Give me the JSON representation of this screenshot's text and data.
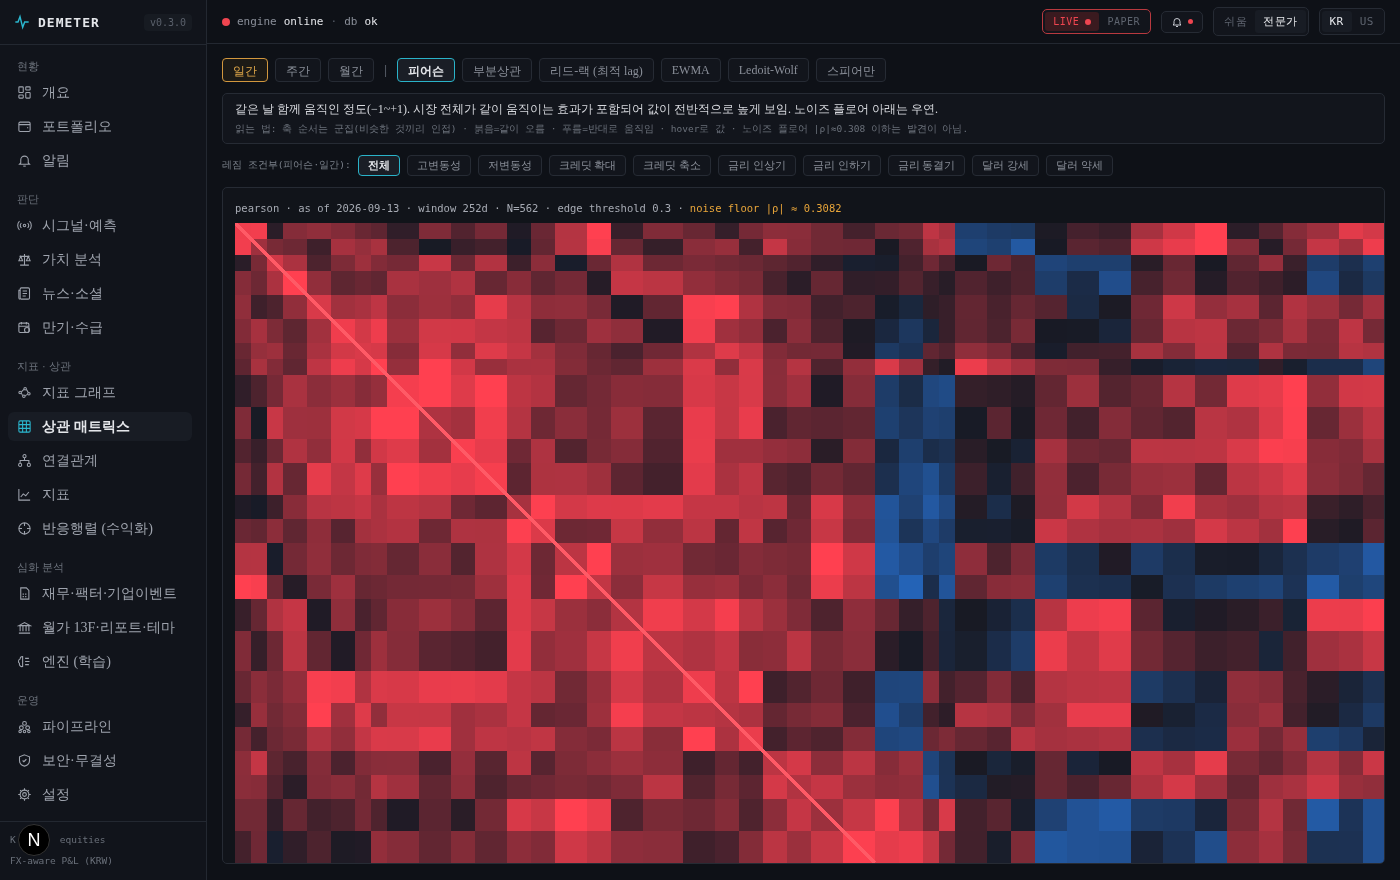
{
  "app": {
    "name": "DEMETER",
    "version": "v0.3.0"
  },
  "status": {
    "engine_label": "engine",
    "engine_state": "online",
    "separator": "·",
    "db_label": "db",
    "db_state": "ok"
  },
  "mode_toggle": [
    {
      "label": "LIVE",
      "selected": true
    },
    {
      "label": "PAPER",
      "selected": false
    }
  ],
  "notifications": {
    "unread": true
  },
  "level_toggle": [
    {
      "label": "쉬움",
      "selected": false
    },
    {
      "label": "전문가",
      "selected": true
    }
  ],
  "market_toggle": [
    {
      "label": "KR",
      "selected": true
    },
    {
      "label": "US",
      "selected": false
    }
  ],
  "sidebar": {
    "sections": [
      {
        "title": "현황",
        "items": [
          {
            "label": "개요",
            "selected": false
          },
          {
            "label": "포트폴리오",
            "selected": false
          },
          {
            "label": "알림",
            "selected": false
          }
        ]
      },
      {
        "title": "판단",
        "items": [
          {
            "label": "시그널·예측",
            "selected": false
          },
          {
            "label": "가치 분석",
            "selected": false
          },
          {
            "label": "뉴스·소셜",
            "selected": false
          },
          {
            "label": "만기·수급",
            "selected": false
          }
        ]
      },
      {
        "title": "지표 · 상관",
        "items": [
          {
            "label": "지표 그래프",
            "selected": false
          },
          {
            "label": "상관 매트릭스",
            "selected": true
          },
          {
            "label": "연결관계",
            "selected": false
          },
          {
            "label": "지표",
            "selected": false
          },
          {
            "label": "반응행렬 (수익화)",
            "selected": false
          }
        ]
      },
      {
        "title": "심화 분석",
        "items": [
          {
            "label": "재무·팩터·기업이벤트",
            "selected": false
          },
          {
            "label": "월가 13F·리포트·테마",
            "selected": false
          },
          {
            "label": "엔진 (학습)",
            "selected": false
          }
        ]
      },
      {
        "title": "운영",
        "items": [
          {
            "label": "파이프라인",
            "selected": false
          },
          {
            "label": "보안·무결성",
            "selected": false
          },
          {
            "label": "설정",
            "selected": false
          }
        ]
      }
    ]
  },
  "footer": {
    "line_1_start": "K",
    "line_1_end": "equities",
    "line_2": "FX-aware P&L (KRW)"
  },
  "dev_badge": {
    "letter": "N"
  },
  "frequency_tabs": [
    {
      "label": "일간",
      "selected": true
    },
    {
      "label": "주간",
      "selected": false
    },
    {
      "label": "월간",
      "selected": false
    }
  ],
  "tab_separator": "|",
  "method_tabs": [
    {
      "label": "피어슨",
      "selected": true
    },
    {
      "label": "부분상관",
      "selected": false
    },
    {
      "label": "리드-랙 (최적 lag)",
      "selected": false
    },
    {
      "label": "EWMA",
      "selected": false
    },
    {
      "label": "Ledoit-Wolf",
      "selected": false
    },
    {
      "label": "스피어만",
      "selected": false
    }
  ],
  "description": {
    "text": "같은 날 함께 움직인 정도(−1~+1). 시장 전체가 같이 움직이는 효과가 포함되어 값이 전반적으로 높게 보임. 노이즈 플로어 아래는 우연.",
    "hint": "읽는 법: 축 순서는 군집(비슷한 것끼리 인접) · 붉음=같이 오름 · 푸름=반대로 움직임 · hover로 값 · 노이즈 플로어 |ρ|≈0.308 이하는 발견이 아님."
  },
  "regime": {
    "label": "레짐 조건부(피어슨·일간):",
    "chips": [
      {
        "label": "전체",
        "selected": true
      },
      {
        "label": "고변동성",
        "selected": false
      },
      {
        "label": "저변동성",
        "selected": false
      },
      {
        "label": "크레딧 확대",
        "selected": false
      },
      {
        "label": "크레딧 축소",
        "selected": false
      },
      {
        "label": "금리 인상기",
        "selected": false
      },
      {
        "label": "금리 인하기",
        "selected": false
      },
      {
        "label": "금리 동결기",
        "selected": false
      },
      {
        "label": "달러 강세",
        "selected": false
      },
      {
        "label": "달러 약세",
        "selected": false
      }
    ]
  },
  "matrix": {
    "caption": "pearson · as of 2026-09-13 · window 252d · N=562 · edge threshold 0.3 ·",
    "noise_floor": "noise floor |ρ| ≈ 0.3082"
  }
}
